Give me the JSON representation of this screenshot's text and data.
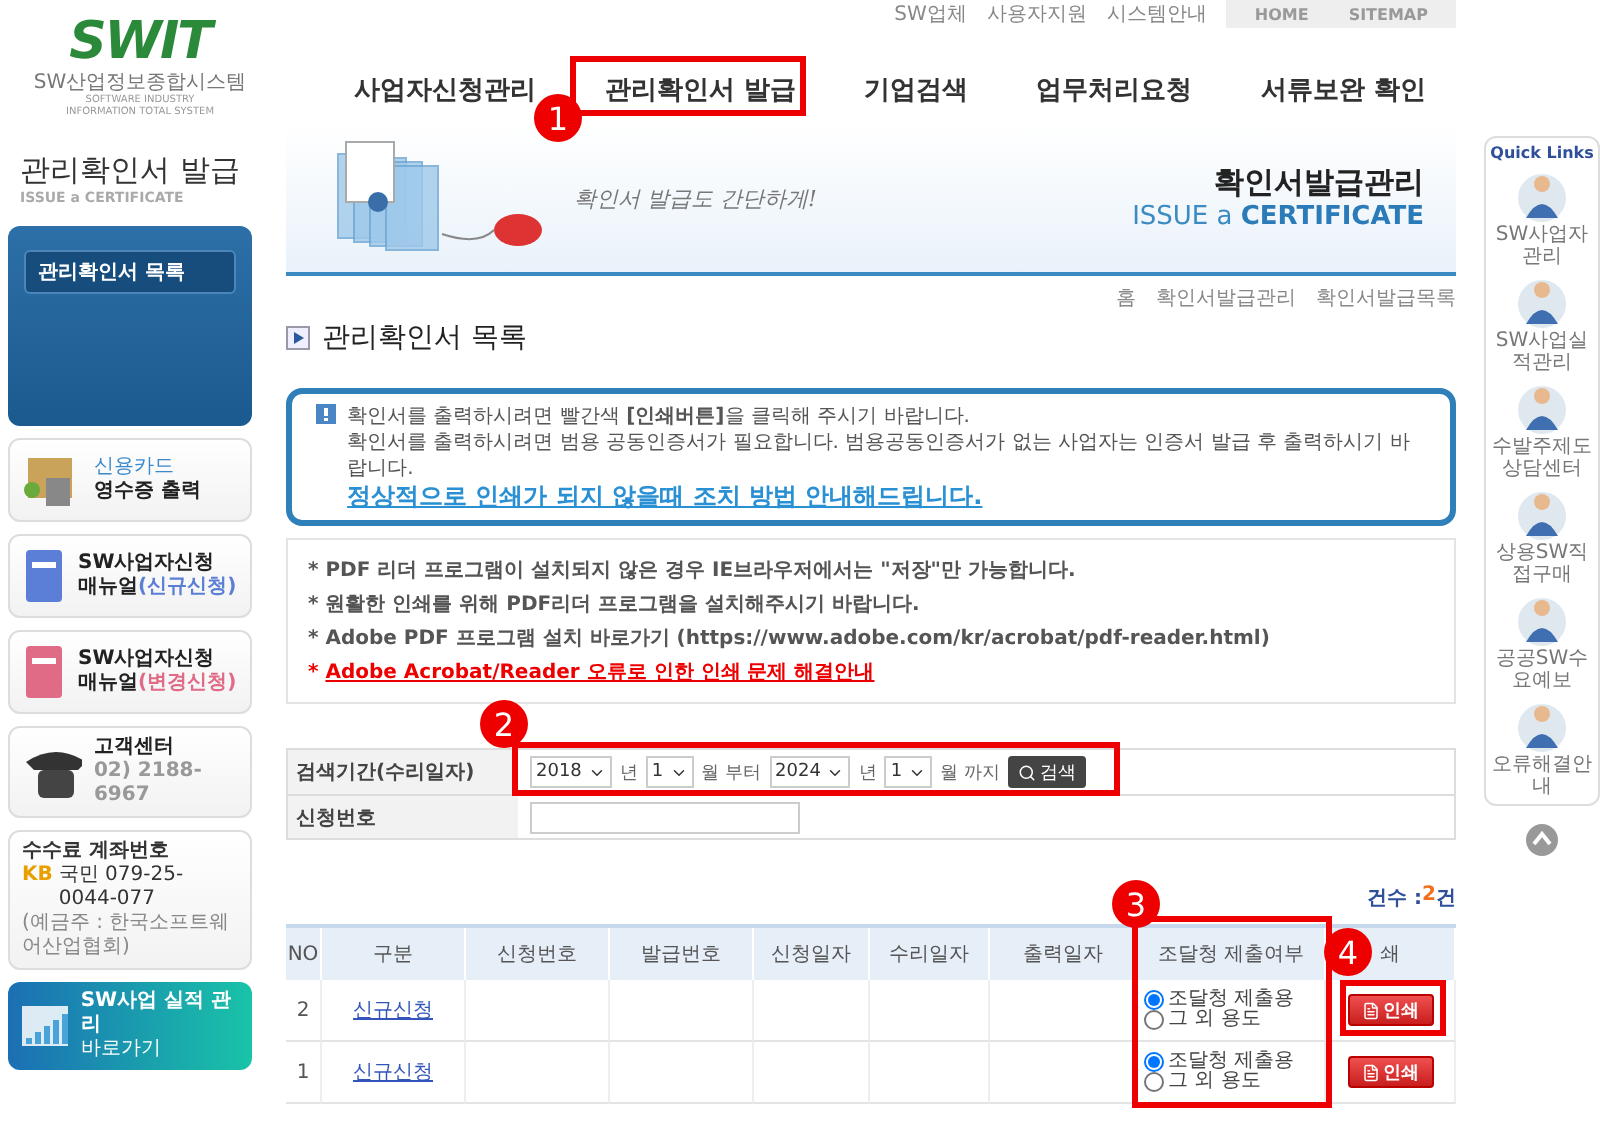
{
  "logo": {
    "mark": "SWIT",
    "subtitle": "SW산업정보종합시스템",
    "tagline": "SOFTWARE INDUSTRY INFORMATION TOTAL SYSTEM"
  },
  "top_links": [
    "SW업체",
    "사용자지원",
    "시스템안내"
  ],
  "top_buttons": [
    "HOME",
    "SITEMAP"
  ],
  "nav": [
    "사업자신청관리",
    "관리확인서 발급",
    "기업검색",
    "업무처리요청",
    "서류보완 확인"
  ],
  "sidebar": {
    "title": "관리확인서 발급",
    "subtitle": "ISSUE a CERTIFICATE",
    "menu": [
      {
        "label": "관리확인서 목록",
        "selected": true
      }
    ],
    "cards": [
      {
        "kind": "receipt",
        "line_1": "신용카드",
        "line_2": "영수증 출력"
      },
      {
        "kind": "manual",
        "color": "#5b7fd6",
        "line_1": "SW사업자신청",
        "line_2": "매뉴얼",
        "note": "(신규신청)"
      },
      {
        "kind": "manual",
        "color": "#e06b86",
        "line_1": "SW사업자신청",
        "line_2": "매뉴얼",
        "note": "(변경신청)"
      },
      {
        "kind": "phone",
        "line_1": "고객센터",
        "line_2": "02) 2188-6967"
      },
      {
        "kind": "account",
        "line_1": "수수료 계좌번호",
        "bank": "KB",
        "line_2": "국민 079-25-0044-077",
        "note": "(예금주 : 한국소프트웨어산업협회)"
      },
      {
        "kind": "shortcut",
        "line_1": "SW사업 실적 관리",
        "line_2": "바로가기"
      }
    ]
  },
  "banner": {
    "slogan": "확인서 발급도 간단하게!",
    "title": "확인서발급관리",
    "subtitle": "ISSUE a **CERTIFICATE**"
  },
  "page_title": "관리확인서 목록",
  "breadcrumb": [
    "홈",
    "확인서발급관리",
    "확인서발급목록"
  ],
  "info": {
    "line_1": "확인서를 출력하시려면 빨간색 **[인쇄버튼]**을 클릭해 주시기 바랍니다.",
    "line_2": "확인서를 출력하시려면 범용 공동인증서가 필요합니다. 범용공동인증서가 없는 사업자는 인증서 발급 후 출력하시기 바랍니다.",
    "link": "정상적으로 인쇄가 되지 않을때 조치 방법 안내해드립니다."
  },
  "notes": [
    {
      "kind": "text",
      "text": "* PDF 리더 프로그램이 설치되지 않은 경우 IE브라우저에서는 \"저장\"만 가능합니다."
    },
    {
      "kind": "text",
      "text": "* 원활한 인쇄를 위해 PDF리더 프로그램을 설치해주시기 바랍니다."
    },
    {
      "kind": "text",
      "text": "* Adobe PDF 프로그램 설치 바로가기 (https://www.adobe.com/kr/acrobat/pdf-reader.html)"
    },
    {
      "kind": "link",
      "bullet": "*",
      "text": "Adobe Acrobat/Reader 오류로 인한 인쇄 문제 해결안내"
    }
  ],
  "search": {
    "period_label": "검색기간(수리일자)",
    "from_year": "2018",
    "year_unit_1": "년",
    "from_month": "1",
    "month_unit_1": "월 부터",
    "to_year": "2024",
    "year_unit_2": "년",
    "to_month": "1",
    "month_unit_2": "월 까지",
    "button": "검색",
    "number_label": "신청번호"
  },
  "count": {
    "label": "건수 : ",
    "value": "2",
    "unit": "건"
  },
  "table": {
    "columns": [
      "NO",
      "구분",
      "신청번호",
      "발급번호",
      "신청일자",
      "수리일자",
      "출력일자",
      "조달청 제출여부",
      "쇄"
    ],
    "rows": [
      {
        "no": "2",
        "type": "신규신청",
        "options": [
          {
            "label": "조달청 제출용",
            "selected": true
          },
          {
            "label": "그 외 용도",
            "selected": false
          }
        ],
        "print": "인쇄"
      },
      {
        "no": "1",
        "type": "신규신청",
        "options": [
          {
            "label": "조달청 제출용",
            "selected": true
          },
          {
            "label": "그 외 용도",
            "selected": false
          }
        ],
        "print": "인쇄"
      }
    ]
  },
  "quick_links": {
    "title": "Quick Links",
    "items": [
      "SW사업자관리",
      "SW사업실적관리",
      "수발주제도상담센터",
      "상용SW직접구매",
      "공공SW수요예보",
      "오류해결안내"
    ]
  },
  "annotations": [
    {
      "number": "1"
    },
    {
      "number": "2"
    },
    {
      "number": "3"
    },
    {
      "number": "4"
    }
  ]
}
